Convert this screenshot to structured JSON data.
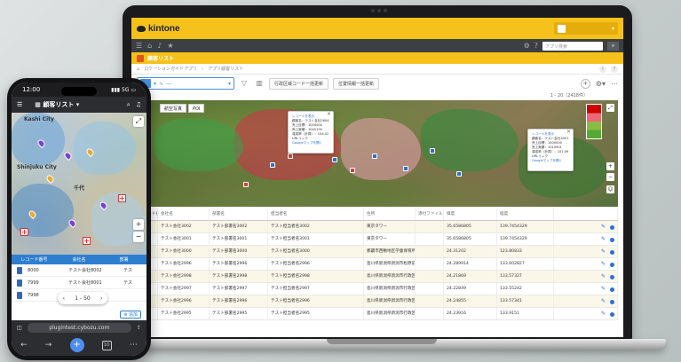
{
  "laptop": {
    "brand": "kintone",
    "nav": {
      "search_placeholder": "アプリ検索"
    },
    "app": {
      "name": "顧客リスト"
    },
    "breadcrumb": [
      "ホーム",
      "ロケーションガイドアプリ",
      "アプリ顧客リスト"
    ],
    "toolbar": {
      "view_label": "一",
      "btn_region": "行政区域コード一括更新",
      "btn_location": "位置情報一括更新"
    },
    "pager_text": "1 - 20（2418件）",
    "map": {
      "tab_aerial": "航空写真",
      "tab_poi": "POI",
      "popup1": {
        "title": "レコードを表示",
        "lines": [
          "顧客名：テスト会社2604",
          "売上目標：1000000",
          "売上実績：1040190",
          "達成率（計算）：104.02",
          "URLリンク",
          "Googleマップを開く"
        ]
      },
      "popup2": {
        "title": "レコードを表示",
        "lines": [
          "顧客名：テスト会社3001",
          "売上目標：1000000",
          "売上実績：1010901",
          "達成率（計算）：101.09",
          "URLリンク",
          "Googleマップを開く"
        ]
      }
    },
    "table": {
      "headers": [
        "レコード番号",
        "会社名",
        "部署名",
        "担当者名",
        "住所",
        "添付ファイル",
        "緯度",
        "経度",
        ""
      ],
      "rows": [
        [
          "30",
          "テスト会社3002",
          "テスト部署名3002",
          "テスト担当者名3002",
          "東京タワー",
          "",
          "35.6586805",
          "139.7454329"
        ],
        [
          "30",
          "テスト会社3001",
          "テスト部署名3001",
          "テスト担当者名3001",
          "東京タワー",
          "",
          "35.6586805",
          "139.7454329"
        ],
        [
          "30",
          "テスト会社3000",
          "テスト部署名3000",
          "テスト担当者名3000",
          "那覇市西敷地区学童保育所",
          "",
          "24.31202",
          "123.80833"
        ],
        [
          "97",
          "テスト会社2996",
          "テスト部署名2996",
          "テスト担当者名2996",
          "島川県新潟県新潟市松原前内...",
          "",
          "24.289914",
          "133.602827"
        ],
        [
          "96",
          "テスト会社2998",
          "テスト部署名2998",
          "テスト担当者名2998",
          "島川県新潟県新潟市行政区域...",
          "",
          "24.21869",
          "133.57327"
        ],
        [
          "95",
          "テスト会社2997",
          "テスト部署名2997",
          "テスト担当者名2997",
          "島川県新潟県新潟市行政区ア...",
          "",
          "24.22849",
          "133.55242"
        ],
        [
          "94",
          "テスト会社2996",
          "テスト部署名2996",
          "テスト担当者名2996",
          "島川県新潟県新潟市行政区き...",
          "",
          "24.24855",
          "133.57341"
        ],
        [
          "93",
          "テスト会社2995",
          "テスト部署名2995",
          "テスト担当者名2995",
          "島川県新潟県新潟市行政区で...",
          "",
          "24.23916",
          "133.9151"
        ]
      ]
    }
  },
  "phone": {
    "time": "12:00",
    "network": "5G",
    "title": "顧客リスト",
    "map_labels": [
      "Shinjuku City",
      "Kashi City",
      "千代"
    ],
    "table_headers": [
      "レコード番号",
      "会社名",
      "部署"
    ],
    "rows": [
      {
        "id": "8000",
        "company": "テスト会社8002",
        "extra": "テス"
      },
      {
        "id": "7999",
        "company": "テスト会社8001",
        "extra": "テス"
      },
      {
        "id": "7998",
        "company": "",
        "extra": ""
      }
    ],
    "pager": "1 - 50",
    "add_button": "追加",
    "url": "plugintest.cybozu.com"
  }
}
